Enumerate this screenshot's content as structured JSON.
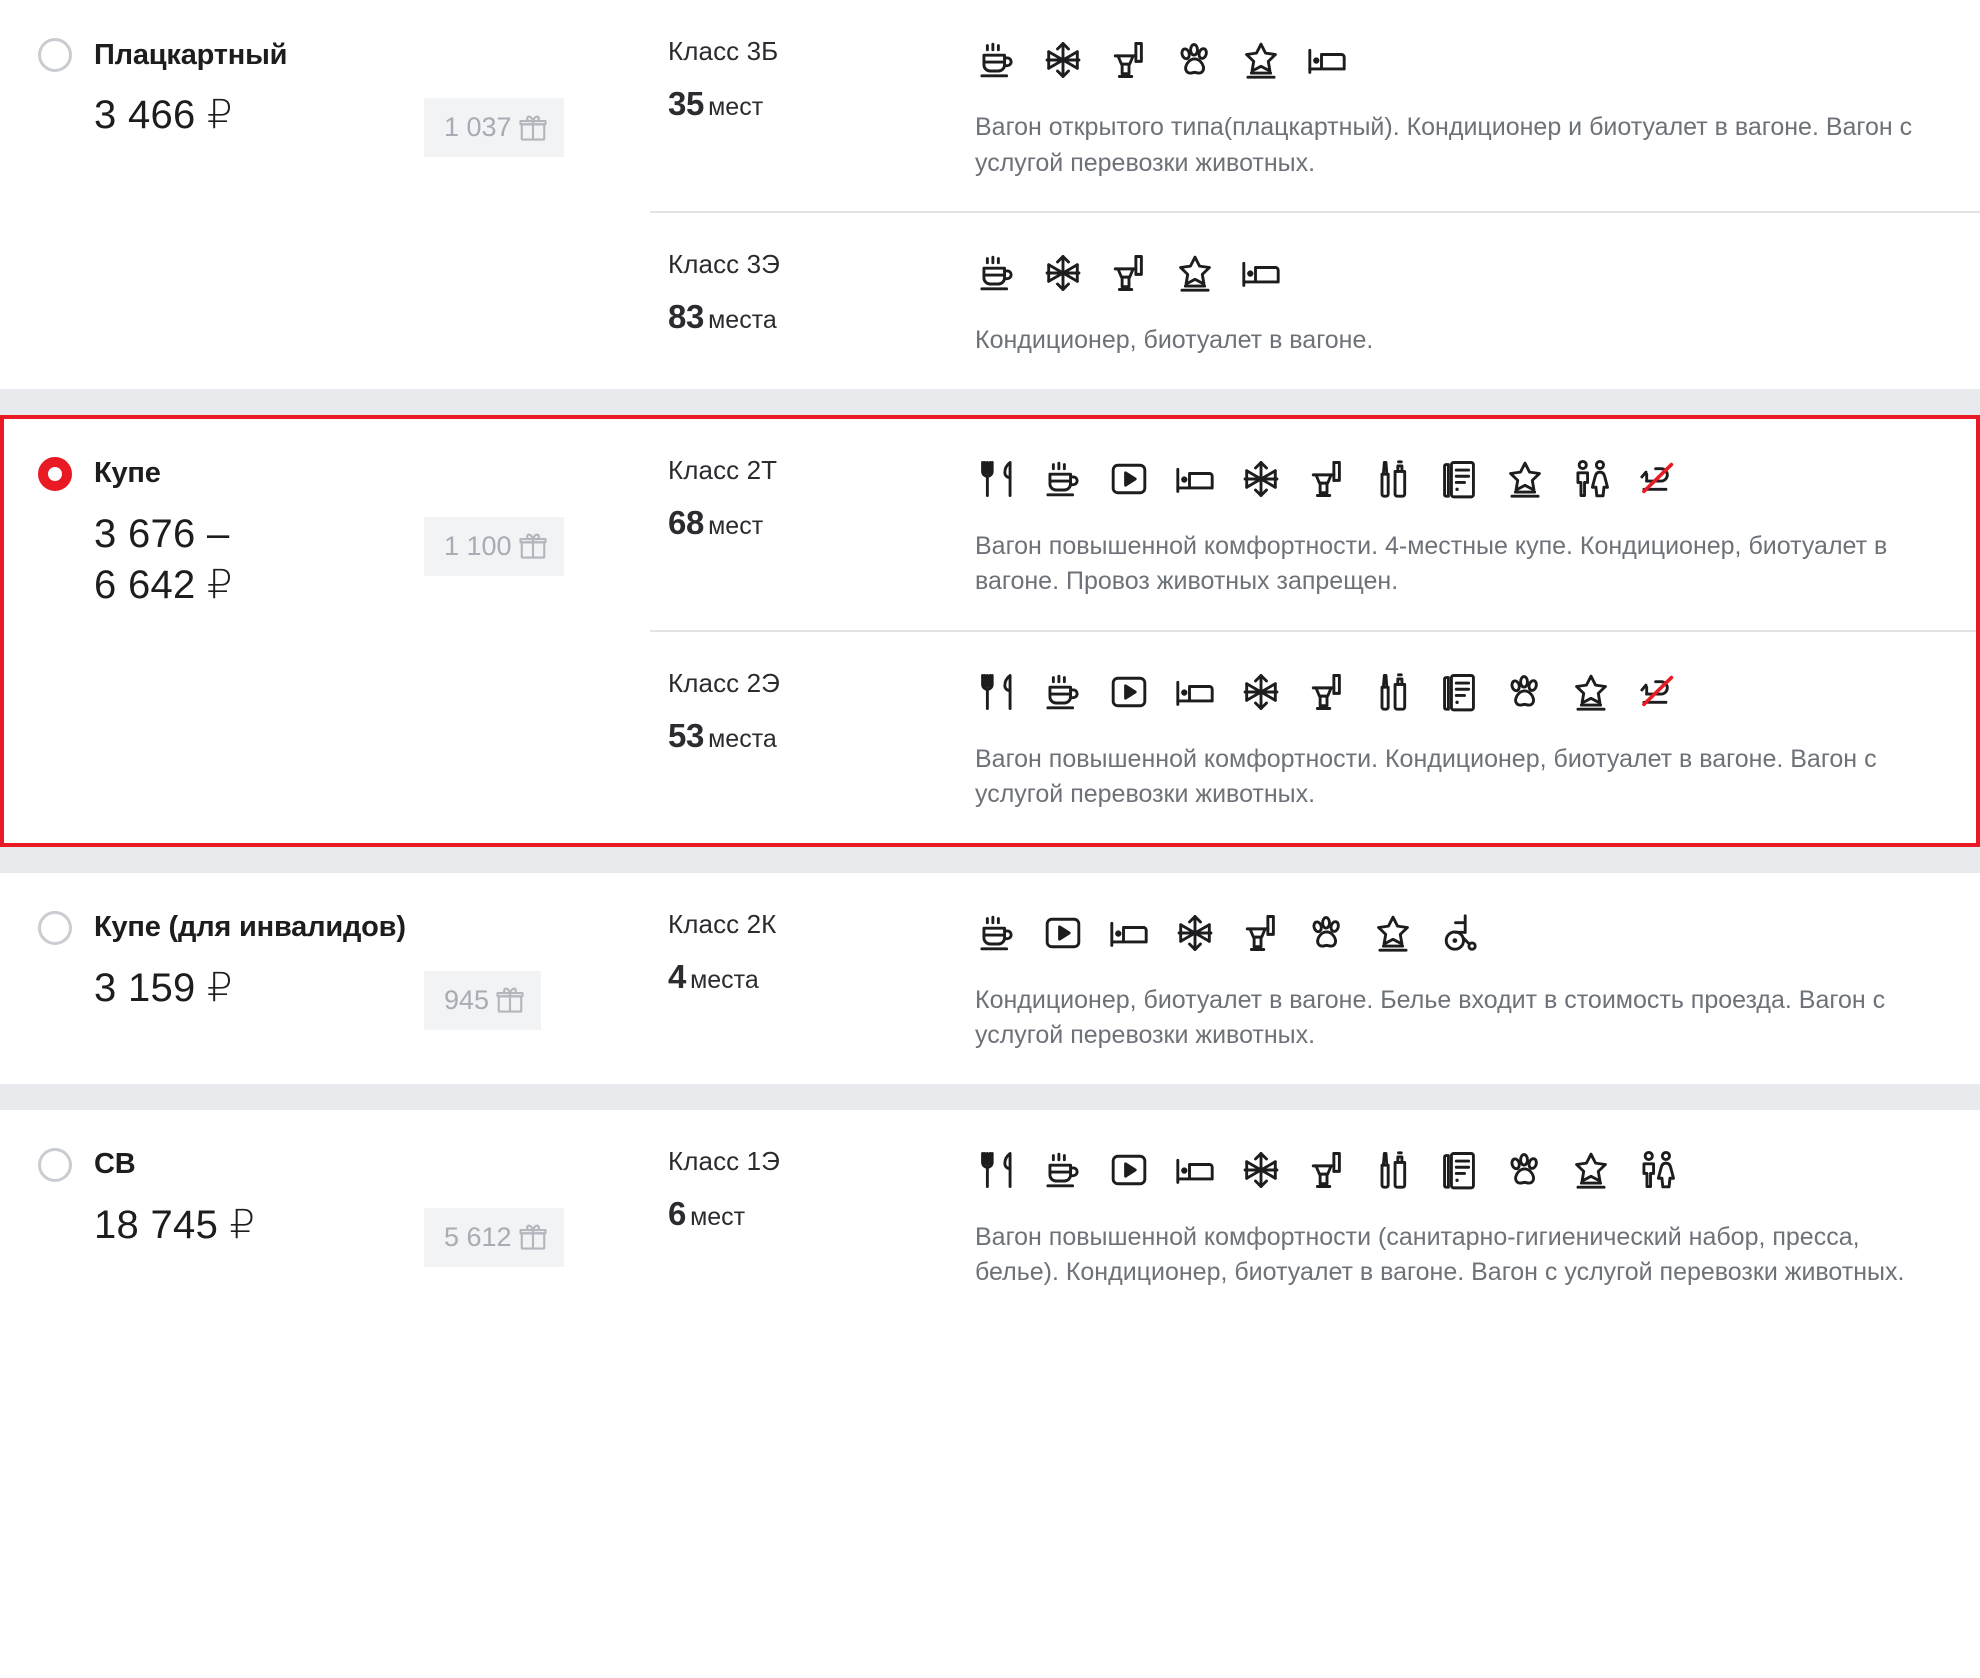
{
  "colors": {
    "accent_red": "#ea1a24",
    "band_gray": "#e8eaed",
    "bonus_bg": "#f2f3f5",
    "bonus_text": "#a7abb3",
    "desc_text": "#6d7278"
  },
  "car_types": [
    {
      "name": "Плацкартный",
      "selected": false,
      "price": "3 466 ₽",
      "bonus": "1 037",
      "classes": [
        {
          "label": "Класс 3Б",
          "seats_number": "35",
          "seats_unit": "мест",
          "icons": [
            "cup-icon",
            "snowflake-icon",
            "toilet-icon",
            "paw-icon",
            "star-icon",
            "bed-icon"
          ],
          "description": "Вагон открытого типа(плацкартный). Кондиционер и биотуалет в вагоне. Вагон с услугой перевозки животных."
        },
        {
          "label": "Класс 3Э",
          "seats_number": "83",
          "seats_unit": "места",
          "icons": [
            "cup-icon",
            "snowflake-icon",
            "toilet-icon",
            "star-icon",
            "bed-icon"
          ],
          "description": "Кондиционер, биотуалет в вагоне."
        }
      ]
    },
    {
      "name": "Купе",
      "selected": true,
      "price": "3 676 –\n6 642 ₽",
      "bonus": "1 100",
      "classes": [
        {
          "label": "Класс 2Т",
          "seats_number": "68",
          "seats_unit": "мест",
          "icons": [
            "meal-icon",
            "cup-icon",
            "video-icon",
            "bed-icon",
            "snowflake-icon",
            "toilet-icon",
            "hygiene-kit-icon",
            "press-icon",
            "star-icon",
            "gender-cabin-icon",
            "no-pets-icon"
          ],
          "description": "Вагон повышенной комфортности. 4-местные купе. Кондиционер, биотуалет в вагоне. Провоз животных запрещен."
        },
        {
          "label": "Класс 2Э",
          "seats_number": "53",
          "seats_unit": "места",
          "icons": [
            "meal-icon",
            "cup-icon",
            "video-icon",
            "bed-icon",
            "snowflake-icon",
            "toilet-icon",
            "hygiene-kit-icon",
            "press-icon",
            "paw-icon",
            "star-icon",
            "no-pets-icon"
          ],
          "description": "Вагон повышенной комфортности. Кондиционер, биотуалет в вагоне. Вагон с услугой перевозки животных."
        }
      ]
    },
    {
      "name": "Купе (для инвалидов)",
      "selected": false,
      "price": "3 159 ₽",
      "bonus": "945",
      "classes": [
        {
          "label": "Класс 2К",
          "seats_number": "4",
          "seats_unit": "места",
          "icons": [
            "cup-icon",
            "video-icon",
            "bed-icon",
            "snowflake-icon",
            "toilet-icon",
            "paw-icon",
            "star-icon",
            "wheelchair-icon"
          ],
          "description": "Кондиционер, биотуалет в вагоне. Белье входит в стоимость проезда. Вагон с услугой перевозки животных."
        }
      ]
    },
    {
      "name": "СВ",
      "selected": false,
      "price": "18 745 ₽",
      "bonus": "5 612",
      "classes": [
        {
          "label": "Класс 1Э",
          "seats_number": "6",
          "seats_unit": "мест",
          "icons": [
            "meal-icon",
            "cup-icon",
            "video-icon",
            "bed-icon",
            "snowflake-icon",
            "toilet-icon",
            "hygiene-kit-icon",
            "press-icon",
            "paw-icon",
            "star-icon",
            "gender-cabin-icon"
          ],
          "description": "Вагон повышенной комфортности (санитарно-гигиенический набор, пресса, белье). Кондиционер, биотуалет в вагоне. Вагон с услугой перевозки животных."
        }
      ]
    }
  ]
}
